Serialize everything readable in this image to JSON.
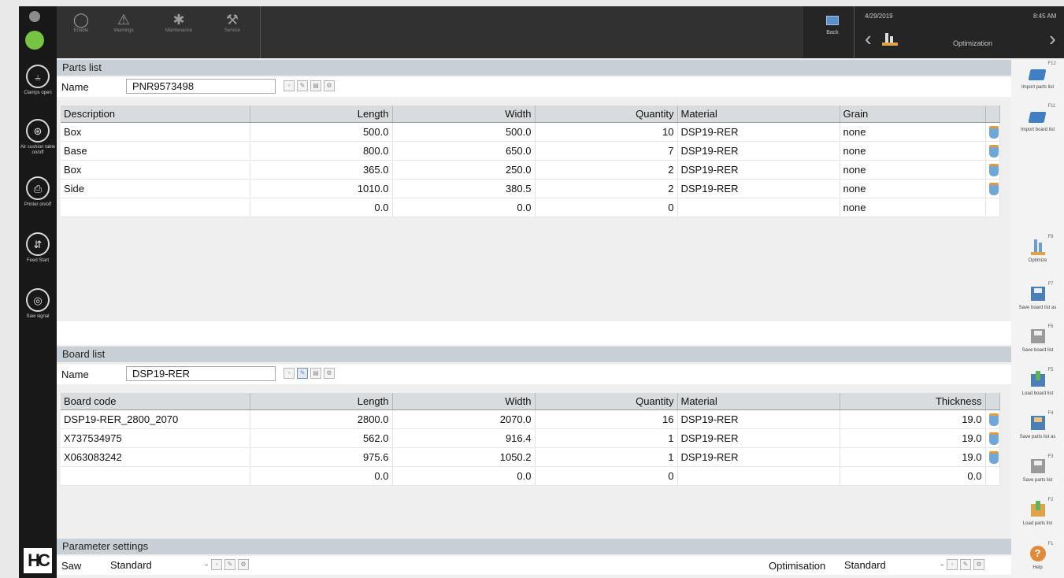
{
  "left_sidebar": {
    "items": [
      {
        "icon": "clamp-icon",
        "label": "Clamps open"
      },
      {
        "icon": "air-cushion-icon",
        "label": "Air cushion table on/off"
      },
      {
        "icon": "printer-icon",
        "label": "Printer on/off"
      },
      {
        "icon": "feed-icon",
        "label": "Feed Start"
      },
      {
        "icon": "saw-icon",
        "label": "Saw signal"
      }
    ],
    "logo": "HC"
  },
  "topbar": {
    "tools": [
      {
        "icon": "circle-tool-icon",
        "label": "Enable"
      },
      {
        "icon": "warning-icon",
        "label": "Warnings"
      },
      {
        "icon": "fuse-icon",
        "label": "Maintenance"
      },
      {
        "icon": "wrench-icon",
        "label": "Service"
      }
    ],
    "back_label": "Back",
    "date": "4/29/2019",
    "time": "8:45 AM",
    "screen_title": "Optimization"
  },
  "parts": {
    "section_title": "Parts list",
    "name_label": "Name",
    "name_value": "PNR9573498",
    "columns": [
      "Description",
      "Length",
      "Width",
      "Quantity",
      "Material",
      "Grain"
    ],
    "rows": [
      [
        "Box",
        "500.0",
        "500.0",
        "10",
        "DSP19-RER",
        "none"
      ],
      [
        "Base",
        "800.0",
        "650.0",
        "7",
        "DSP19-RER",
        "none"
      ],
      [
        "Box",
        "365.0",
        "250.0",
        "2",
        "DSP19-RER",
        "none"
      ],
      [
        "Side",
        "1010.0",
        "380.5",
        "2",
        "DSP19-RER",
        "none"
      ],
      [
        "",
        "0.0",
        "0.0",
        "0",
        "",
        "none"
      ]
    ]
  },
  "boards": {
    "section_title": "Board list",
    "name_label": "Name",
    "name_value": "DSP19-RER",
    "columns": [
      "Board code",
      "Length",
      "Width",
      "Quantity",
      "Material",
      "Thickness"
    ],
    "rows": [
      [
        "DSP19-RER_2800_2070",
        "2800.0",
        "2070.0",
        "16",
        "DSP19-RER",
        "19.0"
      ],
      [
        "X737534975",
        "562.0",
        "916.4",
        "1",
        "DSP19-RER",
        "19.0"
      ],
      [
        "X063083242",
        "975.6",
        "1050.2",
        "1",
        "DSP19-RER",
        "19.0"
      ],
      [
        "",
        "0.0",
        "0.0",
        "0",
        "",
        "0.0"
      ]
    ]
  },
  "parameters": {
    "section_title": "Parameter settings",
    "saw_label": "Saw",
    "saw_value": "Standard",
    "opt_label": "Optimisation",
    "opt_value": "Standard"
  },
  "right_toolbar": {
    "items": [
      {
        "fkey": "F12",
        "label": "Import parts list",
        "icon": "folder-open-icon"
      },
      {
        "fkey": "F11",
        "label": "Import board list",
        "icon": "folder-open-icon"
      },
      {
        "fkey": "F8",
        "label": "Optimize",
        "icon": "optimize-icon"
      },
      {
        "fkey": "F7",
        "label": "Save board list as",
        "icon": "save-as-icon"
      },
      {
        "fkey": "F6",
        "label": "Save board list",
        "icon": "save-icon"
      },
      {
        "fkey": "F5",
        "label": "Load board list",
        "icon": "load-icon"
      },
      {
        "fkey": "F4",
        "label": "Save parts list as",
        "icon": "save-as-icon"
      },
      {
        "fkey": "F3",
        "label": "Save parts list",
        "icon": "save-icon"
      },
      {
        "fkey": "F2",
        "label": "Load parts list",
        "icon": "load-icon"
      },
      {
        "fkey": "F1",
        "label": "Help",
        "icon": "help-icon"
      }
    ]
  },
  "colors": {
    "sidebar_bg": "#181818",
    "topbar_bg": "#313131",
    "section_header_bg": "#c8d0d6",
    "status_green": "#76c442"
  }
}
